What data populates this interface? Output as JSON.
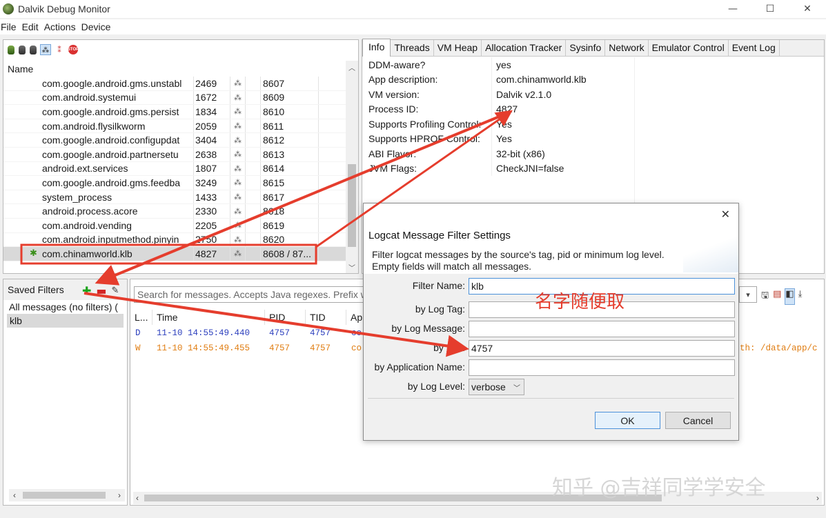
{
  "window": {
    "title": "Dalvik Debug Monitor",
    "minimize_glyph": "—",
    "maximize_glyph": "☐",
    "close_glyph": "✕"
  },
  "menu": [
    "File",
    "Edit",
    "Actions",
    "Device"
  ],
  "devices": {
    "name_header": "Name",
    "rows": [
      {
        "name": "com.google.android.gms.unstabl",
        "pid": "2469",
        "port": "8607"
      },
      {
        "name": "com.android.systemui",
        "pid": "1672",
        "port": "8609"
      },
      {
        "name": "com.google.android.gms.persist",
        "pid": "1834",
        "port": "8610"
      },
      {
        "name": "com.android.flysilkworm",
        "pid": "2059",
        "port": "8611"
      },
      {
        "name": "com.google.android.configupdat",
        "pid": "3404",
        "port": "8612"
      },
      {
        "name": "com.google.android.partnersetu",
        "pid": "2638",
        "port": "8613"
      },
      {
        "name": "android.ext.services",
        "pid": "1807",
        "port": "8614"
      },
      {
        "name": "com.google.android.gms.feedba",
        "pid": "3249",
        "port": "8615"
      },
      {
        "name": "system_process",
        "pid": "1433",
        "port": "8617"
      },
      {
        "name": "android.process.acore",
        "pid": "2330",
        "port": "8618"
      },
      {
        "name": "com.android.vending",
        "pid": "2205",
        "port": "8619"
      },
      {
        "name": "com.android.inputmethod.pinyin",
        "pid": "2750",
        "port": "8620"
      },
      {
        "name": "com.chinamworld.klb",
        "pid": "4827",
        "port": "8608 / 87..."
      }
    ]
  },
  "tabs": [
    "Info",
    "Threads",
    "VM Heap",
    "Allocation Tracker",
    "Sysinfo",
    "Network",
    "Emulator Control",
    "Event Log"
  ],
  "info": [
    {
      "label": "DDM-aware?",
      "value": "yes"
    },
    {
      "label": "App description:",
      "value": "com.chinamworld.klb"
    },
    {
      "label": "VM version:",
      "value": "Dalvik v2.1.0"
    },
    {
      "label": "Process ID:",
      "value": "4827"
    },
    {
      "label": "Supports Profiling Control:",
      "value": "Yes"
    },
    {
      "label": "Supports HPROF Control:",
      "value": "Yes"
    },
    {
      "label": "ABI Flavor:",
      "value": "32-bit (x86)"
    },
    {
      "label": "JVM Flags:",
      "value": "CheckJNI=false"
    }
  ],
  "saved_filters": {
    "title": "Saved Filters",
    "items": [
      "All messages (no filters) (",
      "klb"
    ]
  },
  "logcat": {
    "search_placeholder": "Search for messages. Accepts Java regexes. Prefix w",
    "columns": [
      "L...",
      "Time",
      "PID",
      "TID",
      "Ap"
    ],
    "rows": [
      {
        "level": "D",
        "time": "11-10 14:55:49.440",
        "pid": "4757",
        "tid": "4757",
        "app": "co",
        "tail": ""
      },
      {
        "level": "W",
        "time": "11-10 14:55:49.455",
        "pid": "4757",
        "tid": "4757",
        "app": "co",
        "tail": "th: /data/app/c"
      }
    ]
  },
  "dialog": {
    "title": "Logcat Message Filter Settings",
    "desc_line1": "Filter logcat messages by the source's tag, pid or minimum log level.",
    "desc_line2": "Empty fields will match all messages.",
    "fields": {
      "filter_name": {
        "label": "Filter Name:",
        "value": "klb"
      },
      "log_tag": {
        "label": "by Log Tag:",
        "value": ""
      },
      "log_message": {
        "label": "by Log Message:",
        "value": ""
      },
      "pid": {
        "label": "by PID:",
        "value": "4757"
      },
      "app_name": {
        "label": "by Application Name:",
        "value": ""
      },
      "log_level": {
        "label": "by Log Level:",
        "value": "verbose"
      }
    },
    "ok_label": "OK",
    "cancel_label": "Cancel"
  },
  "annotation_text": "名字随便取",
  "watermark": "知乎 @吉祥同学学安全",
  "colors": {
    "annotation_red": "#e53d2d",
    "log_debug": "#2c3fbd",
    "log_warn": "#e07d12",
    "focus_blue": "#4a90d9"
  }
}
